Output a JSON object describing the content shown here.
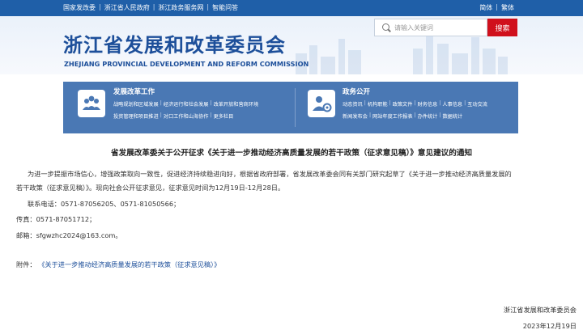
{
  "topbar": {
    "links": [
      "国家发改委",
      "浙江省人民政府",
      "浙江政务服务网",
      "智能问答"
    ],
    "lang": [
      "简体",
      "繁体"
    ]
  },
  "header": {
    "title_cn": "浙江省发展和改革委员会",
    "title_en": "ZHEJIANG PROVINCIAL DEVELOPMENT AND REFORM COMMISSION",
    "search_placeholder": "请输入关键词",
    "search_button": "搜索"
  },
  "nav": {
    "left": {
      "heading": "发展改革工作",
      "row1": [
        "战略规划和区域发展",
        "经济运行和社会发展",
        "改革开放和营商环境"
      ],
      "row2": [
        "投资管理和项目推进",
        "对口工作和山海协作",
        "更多栏目"
      ]
    },
    "right": {
      "heading": "政务公开",
      "row1": [
        "动态资讯",
        "机构职能",
        "政策文件",
        "财务信息",
        "人事信息",
        "互动交流"
      ],
      "row2": [
        "新闻发布会",
        "网站年度工作报表",
        "办件统计",
        "数据统计"
      ]
    }
  },
  "article": {
    "title": "省发展改革委关于公开征求《关于进一步推动经济高质量发展的若干政策（征求意见稿）》意见建议的通知",
    "p1a": "为进一步提振市场信心，增强政策取向一致性，促进经济持续稳进向好，根据省政府部署，省发展改革委会同有关部门研究起草了《关于进一步推动经济高质量发展的",
    "p1b": "若干政策（征求意见稿）》。现向社会公开征求意见，征求意见时间为12月19日-12月28日。",
    "p2": "联系电话：0571-87056205、0571-81050566；",
    "p3": "传真：0571-87051712；",
    "p4": "邮箱：sfgwzhc2024@163.com。",
    "attach_label": "附件：",
    "attach_link": "《关于进一步推动经济高质量发展的若干政策（征求意见稿）》",
    "signature": "浙江省发展和改革委员会",
    "date": "2023年12月19日"
  },
  "colors": {
    "topbar": "#1f5fa8",
    "brand_blue": "#1d4f9a",
    "nav_panel": "#4a78b4",
    "search_button": "#d0101c"
  },
  "icons": {
    "search": "search-icon",
    "nav_left": "people-icon",
    "nav_right": "gear-person-icon"
  }
}
